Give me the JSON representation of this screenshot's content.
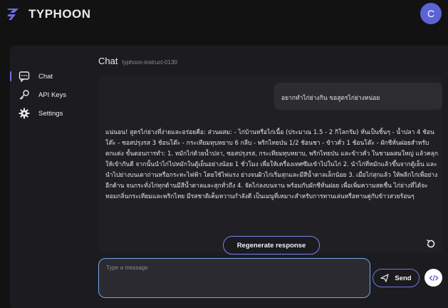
{
  "app": {
    "brand": "TYPHOON",
    "avatar_initial": "C"
  },
  "sidebar": {
    "items": [
      {
        "label": "Chat",
        "icon": "chat-icon",
        "active": true
      },
      {
        "label": "API Keys",
        "icon": "key-icon",
        "active": false
      },
      {
        "label": "Settings",
        "icon": "gear-icon",
        "active": false
      }
    ]
  },
  "chat": {
    "title": "Chat",
    "model": "typhoon-instruct-0130",
    "messages": [
      {
        "role": "user",
        "text": "อยากทำไก่ย่างกิน ขอสูตรไก่ย่างหน่อย"
      },
      {
        "role": "assistant",
        "text": "แน่นอน! สูตรไก่ย่างที่ง่ายและอร่อยคือ: ส่วนผสม: - ไก่บ้านหรือไก่เนื้อ (ประมาณ 1.5 - 2 กิโลกรัม) หั่นเป็นชิ้นๆ - น้ำปลา 4 ช้อนโต๊ะ - ซอสปรุงรส 3 ช้อนโต๊ะ - กระเทียมทุบหยาบ 6 กลีบ - พริกไทยป่น 1/2 ช้อนชา - ข้าวคั่ว 1 ช้อนโต๊ะ - ผักชีหั่นฝอยสำหรับตกแต่ง ขั้นตอนการทำ: 1. หมักไก่ด้วยน้ำปลา, ซอสปรุงรส, กระเทียมทุบหยาบ, พริกไทยป่น และข้าวคั่ว ในชามผสมใหญ่ แล้วคลุกให้เข้ากันดี จากนั้นนำไก่ไปหมักในตู้เย็นอย่างน้อย 1 ชั่วโมง เพื่อให้เครื่องเทศซึมเข้าไปในไก่ 2. นำไก่ที่หมักแล้วขึ้นจากตู้เย็น และนำไปย่างบนเตาถ่านหรือกระทะไฟฟ้า โดยใช้ไฟแรง ย่างจนผิวไก่เริ่มสุกและมีสีน้ำตาลเล็กน้อย 3. เมื่อไก่สุกแล้ว ให้พลิกไก่เพื่อย่างอีกด้าน จนกระทั่งไก่ทุกด้านมีสีน้ำตาลและสุกทั่วถึง 4. จัดไก่ลงบนจาน พร้อมกับผักชีหั่นฝอย เพื่อเพิ่มความสดชื่น ไก่ย่างที่ได้จะหอมกลิ่นกระเทียมและพริกไทย มีรสชาติเค็มหวานกำลังดี เป็นเมนูที่เหมาะสำหรับการทานเล่นหรือทานคู่กับข้าวสวยร้อนๆ"
      }
    ],
    "regenerate_label": "Regenerate response",
    "input_placeholder": "Type a message",
    "input_value": "",
    "send_label": "Send"
  },
  "colors": {
    "accent": "#6e74e6",
    "input_border": "#6fa8e8",
    "avatar": "#5b63d6",
    "logo": "#6f6ae0"
  }
}
